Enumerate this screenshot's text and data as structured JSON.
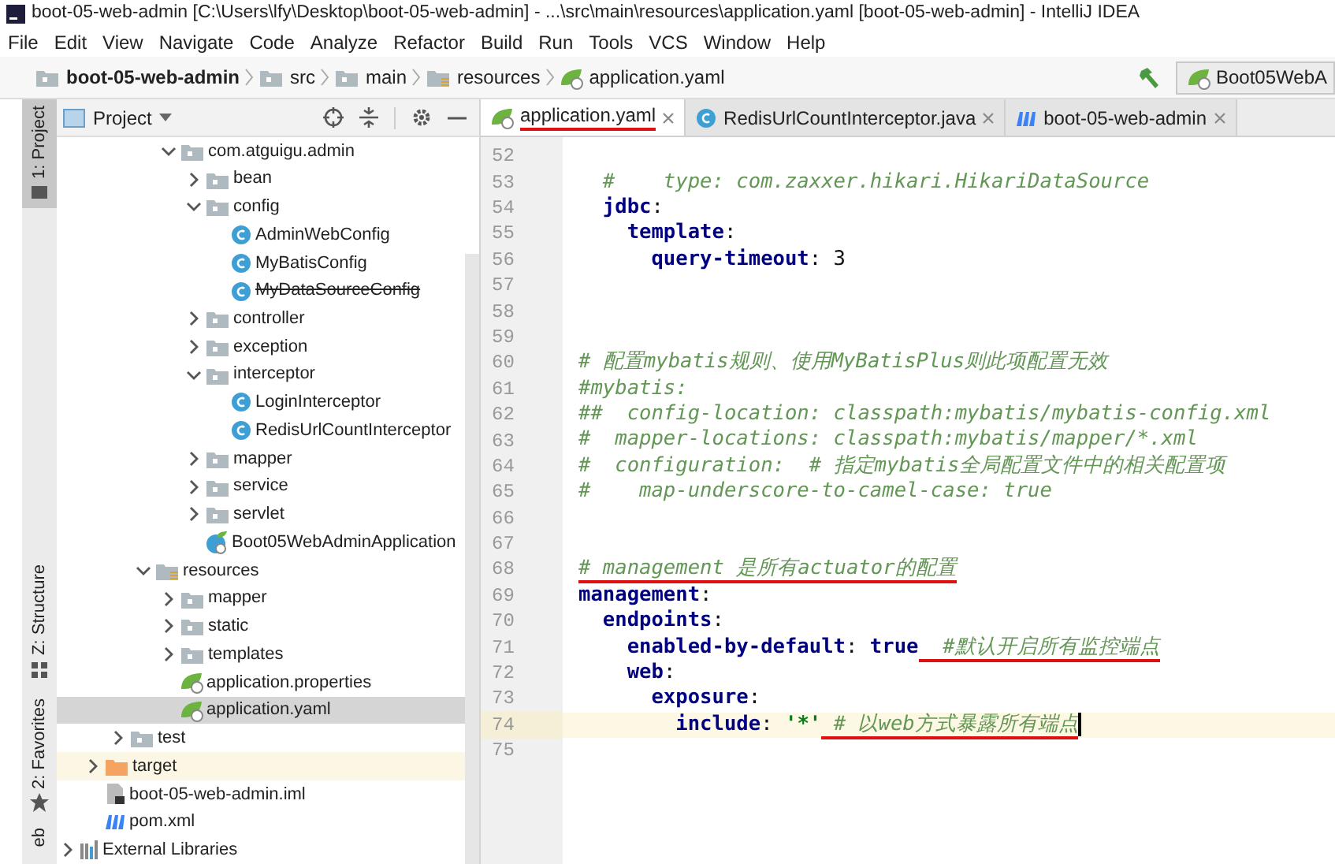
{
  "window": {
    "title": "boot-05-web-admin [C:\\Users\\lfy\\Desktop\\boot-05-web-admin] - ...\\src\\main\\resources\\application.yaml [boot-05-web-admin] - IntelliJ IDEA"
  },
  "menu": [
    "File",
    "Edit",
    "View",
    "Navigate",
    "Code",
    "Analyze",
    "Refactor",
    "Build",
    "Run",
    "Tools",
    "VCS",
    "Window",
    "Help"
  ],
  "breadcrumb": [
    {
      "label": "boot-05-web-admin",
      "kind": "project"
    },
    {
      "label": "src",
      "kind": "folder"
    },
    {
      "label": "main",
      "kind": "folder"
    },
    {
      "label": "resources",
      "kind": "resources"
    },
    {
      "label": "application.yaml",
      "kind": "spring"
    }
  ],
  "run_config": {
    "label": "Boot05WebA"
  },
  "tool_stripe": [
    {
      "label": "1: Project",
      "kind": "folder",
      "selected": true
    },
    {
      "label": "Z: Structure",
      "kind": "structure",
      "selected": false
    },
    {
      "label": "2: Favorites",
      "kind": "star",
      "selected": false
    },
    {
      "label": "eb",
      "kind": "web-cut",
      "selected": false
    }
  ],
  "project_panel": {
    "title": "Project"
  },
  "tree": [
    {
      "children": [
        {
          "children": [
            {
              "children": [
                {
                  "children": [
                    {
                      "label": "com.atguigu.admin",
                      "kind": "package",
                      "expanded": true,
                      "selected": false,
                      "children": [
                        {
                          "label": "bean",
                          "kind": "package",
                          "expanded": false,
                          "selected": false
                        },
                        {
                          "label": "config",
                          "kind": "package",
                          "expanded": true,
                          "selected": false,
                          "children": [
                            {
                              "label": "AdminWebConfig",
                              "kind": "class",
                              "deprecated": false,
                              "selected": false
                            },
                            {
                              "label": "MyBatisConfig",
                              "kind": "class",
                              "deprecated": false,
                              "selected": false
                            },
                            {
                              "label": "MyDataSourceConfig",
                              "kind": "class",
                              "deprecated": true,
                              "selected": false
                            }
                          ]
                        },
                        {
                          "label": "controller",
                          "kind": "package",
                          "expanded": false,
                          "selected": false
                        },
                        {
                          "label": "exception",
                          "kind": "package",
                          "expanded": false,
                          "selected": false
                        },
                        {
                          "label": "interceptor",
                          "kind": "package",
                          "expanded": true,
                          "selected": false,
                          "children": [
                            {
                              "label": "LoginInterceptor",
                              "kind": "class",
                              "deprecated": false,
                              "selected": false
                            },
                            {
                              "label": "RedisUrlCountInterceptor",
                              "kind": "class",
                              "deprecated": false,
                              "selected": false
                            }
                          ]
                        },
                        {
                          "label": "mapper",
                          "kind": "package",
                          "expanded": false,
                          "selected": false
                        },
                        {
                          "label": "service",
                          "kind": "package",
                          "expanded": false,
                          "selected": false
                        },
                        {
                          "label": "servlet",
                          "kind": "package",
                          "expanded": false,
                          "selected": false
                        },
                        {
                          "label": "Boot05WebAdminApplication",
                          "kind": "spring-app",
                          "selected": false
                        }
                      ]
                    }
                  ]
                },
                {
                  "label": "resources",
                  "kind": "resources",
                  "expanded": true,
                  "selected": false,
                  "children": [
                    {
                      "label": "mapper",
                      "kind": "folder",
                      "expanded": false,
                      "selected": false
                    },
                    {
                      "label": "static",
                      "kind": "folder",
                      "expanded": false,
                      "selected": false
                    },
                    {
                      "label": "templates",
                      "kind": "folder",
                      "expanded": false,
                      "selected": false
                    },
                    {
                      "label": "application.properties",
                      "kind": "spring",
                      "selected": false
                    },
                    {
                      "label": "application.yaml",
                      "kind": "spring",
                      "selected": true
                    }
                  ]
                }
              ]
            },
            {
              "label": "test",
              "kind": "folder",
              "expanded": false,
              "selected": false
            }
          ]
        },
        {
          "label": "target",
          "kind": "excluded",
          "expanded": false,
          "selected": false
        },
        {
          "label": "boot-05-web-admin.iml",
          "kind": "iml",
          "selected": false
        },
        {
          "label": "pom.xml",
          "kind": "maven",
          "selected": false
        }
      ]
    },
    {
      "label": "External Libraries",
      "kind": "libraries",
      "expanded": false,
      "selected": false
    }
  ],
  "editor_tabs": [
    {
      "label": "application.yaml",
      "kind": "spring",
      "selected": true,
      "underlined": true
    },
    {
      "label": "RedisUrlCountInterceptor.java",
      "kind": "class",
      "selected": false,
      "underlined": false
    },
    {
      "label": "boot-05-web-admin",
      "kind": "maven",
      "selected": false,
      "underlined": false
    }
  ],
  "code_lines": [
    {
      "number": "52",
      "current": false
    },
    {
      "number": "53",
      "current": false,
      "tokens": [
        {
          "kind": "comment",
          "text": "  #    type: com.zaxxer.hikari.HikariDataSource"
        }
      ]
    },
    {
      "number": "54",
      "current": false,
      "tokens": [
        {
          "kind": "key",
          "text": "  jdbc"
        },
        {
          "kind": "plain",
          "text": ":"
        }
      ]
    },
    {
      "number": "55",
      "current": false,
      "tokens": [
        {
          "kind": "key",
          "text": "    template"
        },
        {
          "kind": "plain",
          "text": ":"
        }
      ]
    },
    {
      "number": "56",
      "current": false,
      "tokens": [
        {
          "kind": "key",
          "text": "      query-timeout"
        },
        {
          "kind": "plain",
          "text": ": 3"
        }
      ]
    },
    {
      "number": "57",
      "current": false
    },
    {
      "number": "58",
      "current": false
    },
    {
      "number": "59",
      "current": false
    },
    {
      "number": "60",
      "current": false,
      "tokens": [
        {
          "kind": "comment",
          "text": "# 配置mybatis规则、使用MyBatisPlus则此项配置无效"
        }
      ]
    },
    {
      "number": "61",
      "current": false,
      "tokens": [
        {
          "kind": "comment",
          "text": "#mybatis:"
        }
      ]
    },
    {
      "number": "62",
      "current": false,
      "tokens": [
        {
          "kind": "comment",
          "text": "##  config-location: classpath:mybatis/mybatis-config.xml"
        }
      ]
    },
    {
      "number": "63",
      "current": false,
      "tokens": [
        {
          "kind": "comment",
          "text": "#  mapper-locations: classpath:mybatis/mapper/*.xml"
        }
      ]
    },
    {
      "number": "64",
      "current": false,
      "tokens": [
        {
          "kind": "comment",
          "text": "#  configuration:  # 指定mybatis全局配置文件中的相关配置项"
        }
      ]
    },
    {
      "number": "65",
      "current": false,
      "tokens": [
        {
          "kind": "comment",
          "text": "#    map-underscore-to-camel-case: true"
        }
      ]
    },
    {
      "number": "66",
      "current": false
    },
    {
      "number": "67",
      "current": false
    },
    {
      "number": "68",
      "current": false,
      "tokens": [
        {
          "kind": "comment",
          "text": "# management 是所有actuator的配置",
          "underlined": true
        }
      ]
    },
    {
      "number": "69",
      "current": false,
      "tokens": [
        {
          "kind": "key",
          "text": "management"
        },
        {
          "kind": "plain",
          "text": ":"
        }
      ]
    },
    {
      "number": "70",
      "current": false,
      "tokens": [
        {
          "kind": "key",
          "text": "  endpoints"
        },
        {
          "kind": "plain",
          "text": ":"
        }
      ]
    },
    {
      "number": "71",
      "current": false,
      "tokens": [
        {
          "kind": "key",
          "text": "    enabled-by-default"
        },
        {
          "kind": "plain",
          "text": ": "
        },
        {
          "kind": "bool",
          "text": "true"
        },
        {
          "kind": "comment",
          "text": "  #默认开启所有监控端点",
          "underlined": true
        }
      ]
    },
    {
      "number": "72",
      "current": false,
      "tokens": [
        {
          "kind": "key",
          "text": "    web"
        },
        {
          "kind": "plain",
          "text": ":"
        }
      ]
    },
    {
      "number": "73",
      "current": false,
      "tokens": [
        {
          "kind": "key",
          "text": "      exposure"
        },
        {
          "kind": "plain",
          "text": ":"
        }
      ]
    },
    {
      "number": "74",
      "current": true,
      "tokens": [
        {
          "kind": "key",
          "text": "        include"
        },
        {
          "kind": "plain",
          "text": ": "
        },
        {
          "kind": "string",
          "text": "'*'"
        },
        {
          "kind": "comment",
          "text": " # 以web方式暴露所有端点",
          "underlined": true
        }
      ]
    },
    {
      "number": "75",
      "current": false
    }
  ]
}
